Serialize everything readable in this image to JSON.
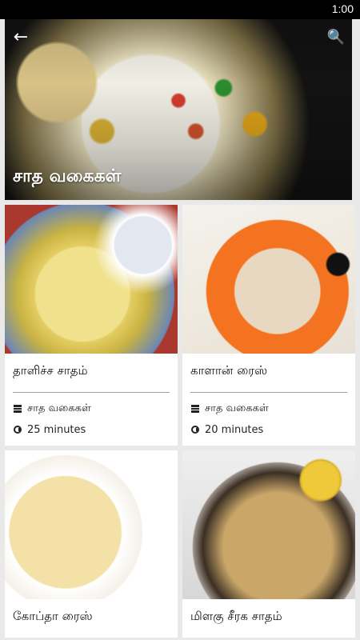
{
  "status": {
    "time": "1:00"
  },
  "hero": {
    "title": "சாத வகைகள்"
  },
  "cards": [
    {
      "title": "தாளிச்ச சாதம்",
      "category": "சாத வகைகள்",
      "time": "25 minutes"
    },
    {
      "title": "காளான் ரைஸ்",
      "category": "சாத வகைகள்",
      "time": "20 minutes"
    },
    {
      "title": "கோப்தா ரைஸ்"
    },
    {
      "title": "மிளகு சீரக சாதம்"
    }
  ],
  "colors": {
    "status_bar": "#000000",
    "card_bg": "#ffffff",
    "page_bg": "#e9e9e9"
  },
  "icons": {
    "back": "arrow-left",
    "search": "magnifier",
    "category": "stack",
    "time": "clock"
  }
}
